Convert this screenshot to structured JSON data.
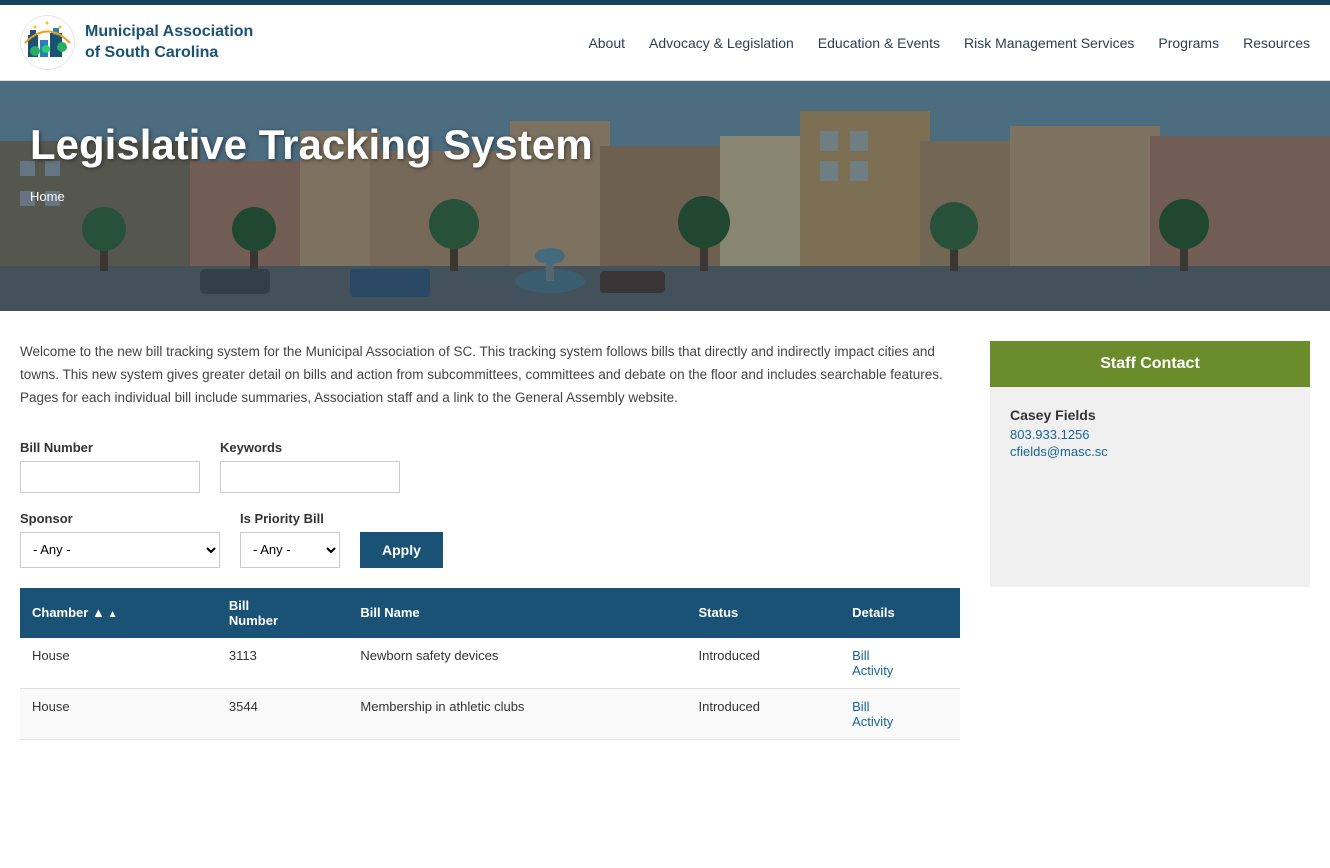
{
  "topBar": {},
  "header": {
    "logoLine1": "Municipal Association",
    "logoLine2": "of South Carolina",
    "nav": [
      {
        "label": "About",
        "id": "about"
      },
      {
        "label": "Advocacy & Legislation",
        "id": "advocacy"
      },
      {
        "label": "Education & Events",
        "id": "education"
      },
      {
        "label": "Risk Management Services",
        "id": "risk"
      },
      {
        "label": "Programs",
        "id": "programs"
      },
      {
        "label": "Resources",
        "id": "resources"
      }
    ]
  },
  "hero": {
    "title": "Legislative Tracking System",
    "breadcrumb": "Home"
  },
  "content": {
    "intro": "Welcome to the new bill tracking system for the Municipal Association of SC. This tracking system follows bills that directly and indirectly impact cities and towns. This new system gives greater detail on bills and action from subcommittees, committees and debate on the floor and includes searchable features. Pages for each individual bill include summaries, Association staff and a link to the General Assembly website."
  },
  "form": {
    "billNumberLabel": "Bill Number",
    "billNumberPlaceholder": "",
    "keywordsLabel": "Keywords",
    "keywordsPlaceholder": "",
    "sponsorLabel": "Sponsor",
    "sponsorDefault": "- Any -",
    "priorityLabel": "Is Priority Bill",
    "priorityDefault": "- Any -",
    "applyLabel": "Apply"
  },
  "table": {
    "columns": [
      {
        "label": "Chamber",
        "key": "chamber",
        "sortable": true
      },
      {
        "label": "Bill\nNumber",
        "key": "billNumber"
      },
      {
        "label": "Bill Name",
        "key": "billName"
      },
      {
        "label": "Status",
        "key": "status"
      },
      {
        "label": "Details",
        "key": "details"
      }
    ],
    "rows": [
      {
        "chamber": "House",
        "billNumber": "3113",
        "billName": "Newborn safety devices",
        "status": "Introduced",
        "detailBill": "Bill",
        "detailActivity": "Activity"
      },
      {
        "chamber": "House",
        "billNumber": "3544",
        "billName": "Membership in athletic clubs",
        "status": "Introduced",
        "detailBill": "Bill",
        "detailActivity": "Activity"
      }
    ]
  },
  "sidebar": {
    "staffContactHeader": "Staff Contact",
    "staffName": "Casey Fields",
    "staffPhone": "803.933.1256",
    "staffEmail": "cfields@masc.sc"
  }
}
